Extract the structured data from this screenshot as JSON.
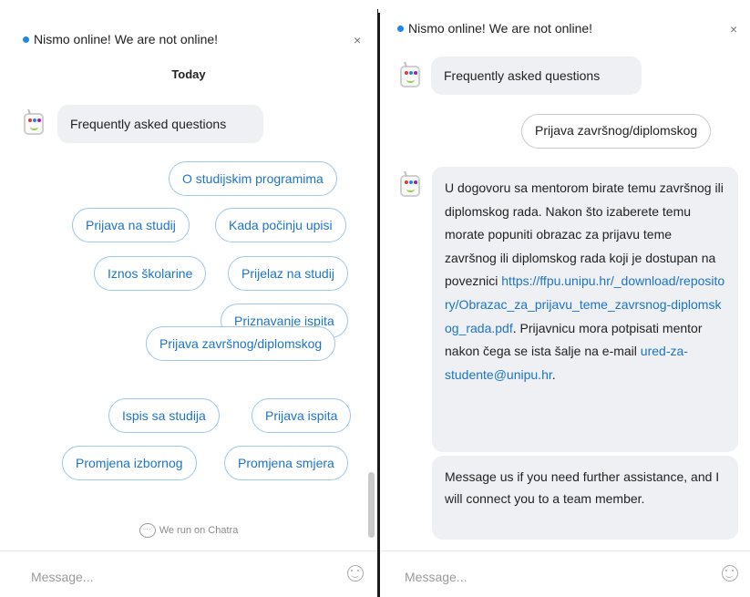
{
  "left": {
    "status_text": "Nismo online! We are not online!",
    "close_label": "×",
    "date_label": "Today",
    "faq_message": "Frequently asked questions",
    "quick_replies": [
      "O studijskim programima",
      "Prijava na studij",
      "Kada počinju upisi",
      "Iznos školarine",
      "Prijelaz na studij",
      "Priznavanje ispita",
      "Prijava završnog/diplomskog",
      "Ispis sa studija",
      "Prijava ispita",
      "Promjena izbornog",
      "Promjena smjera"
    ],
    "powered_by": "We run on Chatra",
    "message_placeholder": "Message..."
  },
  "right": {
    "status_text": "Nismo online! We are not online!",
    "close_label": "×",
    "faq_message": "Frequently asked questions",
    "user_message": "Prijava završnog/diplomskog",
    "answer_text": "U dogovoru sa mentorom birate temu završnog ili diplomskog rada. Nakon što izaberete temu morate popuniti obrazac za prijavu teme završnog ili diplomskog rada koji je dostupan na poveznici",
    "answer_link": "https://ffpu.unipu.hr/_download/repository/Obrazac_za_prijavu_teme_zavrsnog-diplomskog_rada.pdf",
    "answer_text_2": ". Prijavnicu mora potpisati mentor nakon čega se ista šalje na e-mail",
    "answer_email": "ured-za-studente@unipu.hr",
    "answer_end": ".",
    "followup_message": "Message us if you need further assistance, and I will connect you to a team member.",
    "message_placeholder": "Message..."
  },
  "colors": {
    "accent": "#1d74c9",
    "status_dot": "#1e88e5",
    "bubble_bg": "#eef0f3",
    "button_border": "#9cc7ea"
  },
  "icons": {
    "bot_avatar": "bot-avatar-icon",
    "close": "close-icon",
    "emoji": "smiley-icon",
    "chatra": "chatra-logo-icon"
  }
}
